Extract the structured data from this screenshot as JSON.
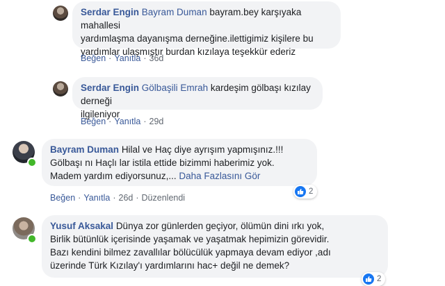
{
  "comments": [
    {
      "author": "Serdar Engin",
      "mention": "Bayram Duman",
      "lines": [
        "bayram.bey karşıyaka mahallesi",
        "yardımlaşma dayanışma derneğine.ilettigimiz kişilere bu",
        "yardımlar ulaşmıştır burdan kızılaya teşekkür ederiz"
      ],
      "actions": {
        "like": "Beğen",
        "reply": "Yanıtla",
        "time": "36d"
      }
    },
    {
      "author": "Serdar Engin",
      "mention": "Gölbaşili Emrah",
      "lines": [
        "kardeşim gölbaşı kızılay derneği",
        "ilgileniyor"
      ],
      "actions": {
        "like": "Beğen",
        "reply": "Yanıtla",
        "time": "29d"
      }
    },
    {
      "author": "Bayram Duman",
      "lines": [
        "Hilal ve Haç diye ayrışım yapmışınız.!!!",
        "Gölbaşı nı Haçlı lar istila ettide bizimmi haberimiz yok.",
        "Madem yardım ediyorsunuz,..."
      ],
      "see_more": "Daha Fazlasını Gör",
      "reaction_count": "2",
      "actions": {
        "like": "Beğen",
        "reply": "Yanıtla",
        "time": "26d",
        "edited": "Düzenlendi"
      }
    },
    {
      "author": "Yusuf Aksakal",
      "lines": [
        "Dünya zor günlerden geçiyor, ölümün dini ırkı yok,",
        "Birlik bütünlük içerisinde yaşamak ve yaşatmak hepimizin görevidir.",
        "Bazı kendini bilmez zavallılar bölücülük yapmaya devam ediyor ,adı",
        "üzerinde Türk Kızılay'ı yardımlarını hac+ değil ne demek?"
      ],
      "reaction_count": "2"
    }
  ],
  "colors": {
    "name_link": "#385898",
    "bubble_bg": "#f2f3f5",
    "like_blue": "#1877f2",
    "online": "#42b72a"
  }
}
